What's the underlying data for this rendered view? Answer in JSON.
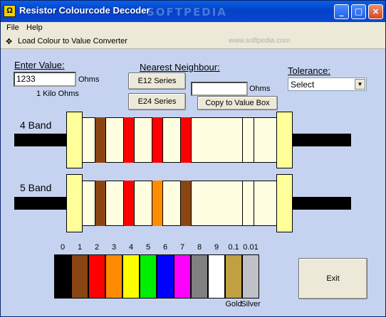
{
  "window": {
    "title": "Resistor Colourcode Decoder",
    "watermark": "SOFTPEDIA",
    "url_watermark": "www.softpedia.com",
    "minimize": "_",
    "maximize": "□",
    "close": "×"
  },
  "menu": {
    "file": "File",
    "help": "Help"
  },
  "toolbar": {
    "load_converter": "Load Colour to Value Converter",
    "icon": "✥"
  },
  "enter_value": {
    "label": "Enter Value:",
    "value": "1233",
    "unit": "Ohms",
    "readout": "1 Kilo Ohms"
  },
  "nearest": {
    "label": "Nearest Neighbour:",
    "e12": "E12 Series",
    "e24": "E24 Series",
    "value": "",
    "unit": "Ohms",
    "copy": "Copy to Value Box"
  },
  "tolerance": {
    "label": "Tolerance:",
    "selected": "Select"
  },
  "resistors": {
    "four_band": {
      "label": "4 Band",
      "bands": [
        "#8b4513",
        "#ff0000",
        "#ff0000",
        "#ff0000"
      ]
    },
    "five_band": {
      "label": "5 Band",
      "bands": [
        "#8b4513",
        "#ff0000",
        "#ff8c00",
        "#8b4513"
      ]
    }
  },
  "palette": {
    "digits": [
      "0",
      "1",
      "2",
      "3",
      "4",
      "5",
      "6",
      "7",
      "8",
      "9",
      "0.1",
      "0.01"
    ],
    "colors": [
      "#000000",
      "#8b4513",
      "#ff0000",
      "#ff8c00",
      "#ffff00",
      "#00ee00",
      "#0000ff",
      "#ff00ff",
      "#808080",
      "#ffffff",
      "#c0a040",
      "#c0c0c8"
    ],
    "names": [
      "",
      "",
      "",
      "",
      "",
      "",
      "",
      "",
      "",
      "",
      "Gold",
      "Silver"
    ]
  },
  "exit": "Exit"
}
